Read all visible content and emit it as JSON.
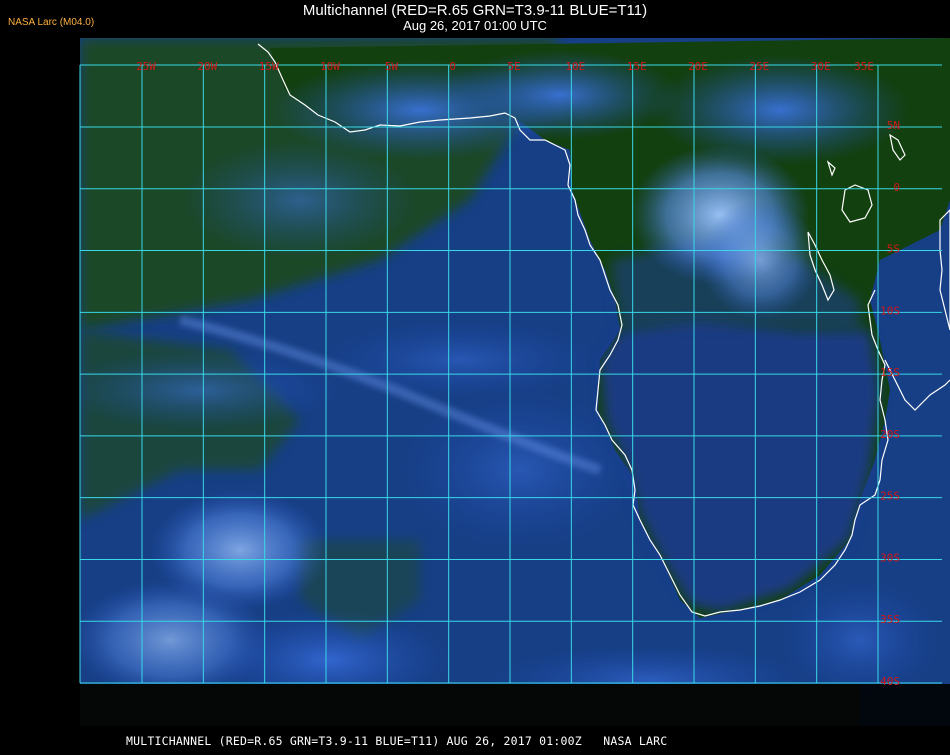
{
  "header": {
    "title": "Multichannel (RED=R.65 GRN=T3.9-11 BLUE=T11)",
    "datetime": "Aug 26, 2017 01:00 UTC",
    "producer": "NASA Larc (M04.0)"
  },
  "footer": {
    "caption": "MULTICHANNEL (RED=R.65 GRN=T3.9-11 BLUE=T11) AUG 26, 2017 01:00Z   NASA LARC"
  },
  "map": {
    "longitude_labels": [
      "25W",
      "20W",
      "15W",
      "10W",
      "5W",
      "0",
      "5E",
      "10E",
      "15E",
      "20E",
      "25E",
      "30E",
      "35E"
    ],
    "latitude_labels": [
      "5N",
      "0",
      "5S",
      "10S",
      "15S",
      "20S",
      "25S",
      "30S",
      "35S",
      "40S"
    ],
    "colors": {
      "grid": "#38d8e8",
      "coastline": "#ffffff",
      "label": "#d01818",
      "land": "#14400f",
      "ocean": "#1a3e8a",
      "cloud": "#5a90f0"
    }
  }
}
